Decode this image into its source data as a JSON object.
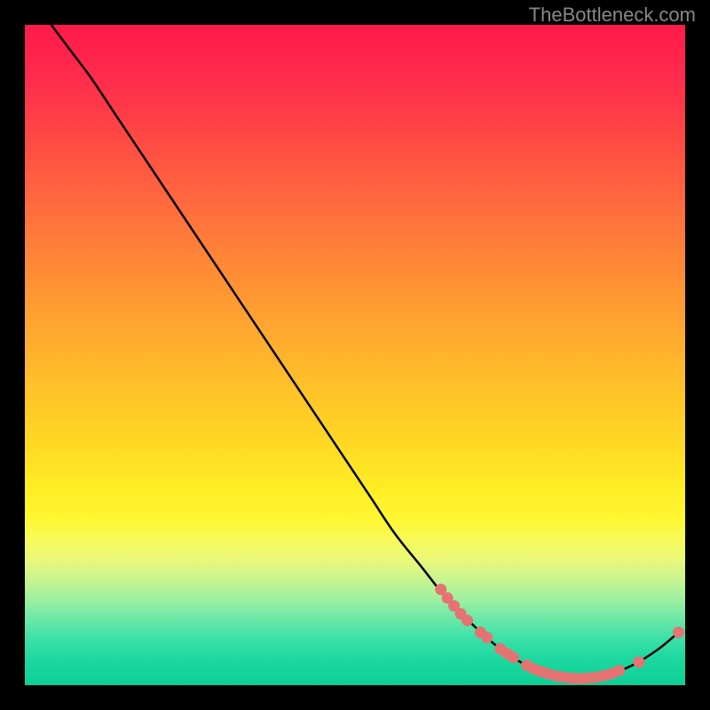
{
  "watermark": "TheBottleneck.com",
  "chart_data": {
    "type": "line",
    "title": "",
    "xlabel": "",
    "ylabel": "",
    "xlim": [
      0,
      100
    ],
    "ylim": [
      0,
      100
    ],
    "curve": [
      {
        "x": 4,
        "y": 100
      },
      {
        "x": 7,
        "y": 96
      },
      {
        "x": 10,
        "y": 92
      },
      {
        "x": 14,
        "y": 86
      },
      {
        "x": 20,
        "y": 77
      },
      {
        "x": 28,
        "y": 65
      },
      {
        "x": 36,
        "y": 53
      },
      {
        "x": 44,
        "y": 41
      },
      {
        "x": 52,
        "y": 29
      },
      {
        "x": 56,
        "y": 23
      },
      {
        "x": 60,
        "y": 18
      },
      {
        "x": 64,
        "y": 13
      },
      {
        "x": 68,
        "y": 9
      },
      {
        "x": 72,
        "y": 5.5
      },
      {
        "x": 76,
        "y": 3
      },
      {
        "x": 80,
        "y": 1.5
      },
      {
        "x": 84,
        "y": 1
      },
      {
        "x": 88,
        "y": 1.5
      },
      {
        "x": 92,
        "y": 3
      },
      {
        "x": 96,
        "y": 5.5
      },
      {
        "x": 99,
        "y": 8
      }
    ],
    "markers": [
      {
        "x": 63,
        "y": 14.5
      },
      {
        "x": 64,
        "y": 13.2
      },
      {
        "x": 65,
        "y": 12
      },
      {
        "x": 66,
        "y": 10.8
      },
      {
        "x": 67,
        "y": 9.8
      },
      {
        "x": 69,
        "y": 8
      },
      {
        "x": 70,
        "y": 7.2
      },
      {
        "x": 72,
        "y": 5.5
      },
      {
        "x": 73,
        "y": 4.8
      },
      {
        "x": 74,
        "y": 4.2
      },
      {
        "x": 76,
        "y": 3
      },
      {
        "x": 77,
        "y": 2.5
      },
      {
        "x": 78,
        "y": 2.1
      },
      {
        "x": 79,
        "y": 1.8
      },
      {
        "x": 80,
        "y": 1.5
      },
      {
        "x": 81,
        "y": 1.3
      },
      {
        "x": 82,
        "y": 1.15
      },
      {
        "x": 83,
        "y": 1.05
      },
      {
        "x": 84,
        "y": 1
      },
      {
        "x": 85,
        "y": 1.05
      },
      {
        "x": 86,
        "y": 1.15
      },
      {
        "x": 87,
        "y": 1.3
      },
      {
        "x": 88,
        "y": 1.5
      },
      {
        "x": 89,
        "y": 1.8
      },
      {
        "x": 90,
        "y": 2.2
      },
      {
        "x": 93,
        "y": 3.5
      },
      {
        "x": 99,
        "y": 8
      }
    ],
    "marker_color": "#e57373",
    "curve_color": "#000000"
  }
}
